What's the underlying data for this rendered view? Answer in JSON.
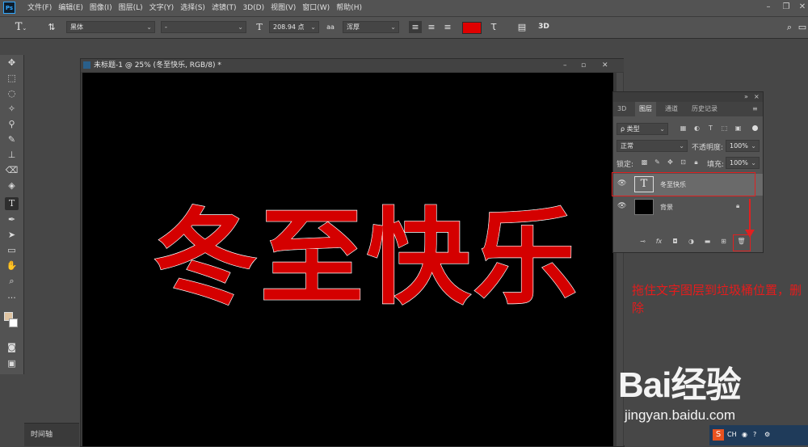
{
  "menubar": {
    "logo": "Ps",
    "items": [
      "文件(F)",
      "编辑(E)",
      "图像(I)",
      "图层(L)",
      "文字(Y)",
      "选择(S)",
      "滤镜(T)",
      "3D(D)",
      "视图(V)",
      "窗口(W)",
      "帮助(H)"
    ]
  },
  "options": {
    "font_family": "黑体",
    "font_style": "-",
    "font_size": "208.94 点",
    "antialias": "浑厚",
    "text_color": "#e00000",
    "label_3d": "3D"
  },
  "document": {
    "title": "未标题-1 @ 25% (冬至快乐, RGB/8) *",
    "canvas_text": [
      "冬",
      "至",
      "快",
      "乐"
    ]
  },
  "timeline": {
    "label": "时间轴"
  },
  "layers_panel": {
    "tabs": [
      "3D",
      "图层",
      "通道",
      "历史记录"
    ],
    "active_tab": "图层",
    "filter_label": "ρ 类型",
    "blend_mode": "正常",
    "opacity_label": "不透明度:",
    "opacity_value": "100%",
    "lock_label": "锁定:",
    "fill_label": "填充:",
    "fill_value": "100%",
    "layers": [
      {
        "name": "冬至快乐",
        "thumb": "T",
        "selected": true
      },
      {
        "name": "背景",
        "thumb": "",
        "selected": false,
        "locked": true
      }
    ],
    "footer_icons": [
      "link-icon",
      "fx-icon",
      "mask-icon",
      "adjustment-icon",
      "folder-icon",
      "new-layer-icon",
      "trash-icon"
    ],
    "footer_fx": "fx"
  },
  "annotation": {
    "text": "拖住文字图层到垃圾桶位置，删除",
    "color": "#e51c1c"
  },
  "watermark": {
    "logo": "Bai经验",
    "url": "jingyan.baidu.com"
  },
  "taskbar": {
    "lang": "CH"
  }
}
